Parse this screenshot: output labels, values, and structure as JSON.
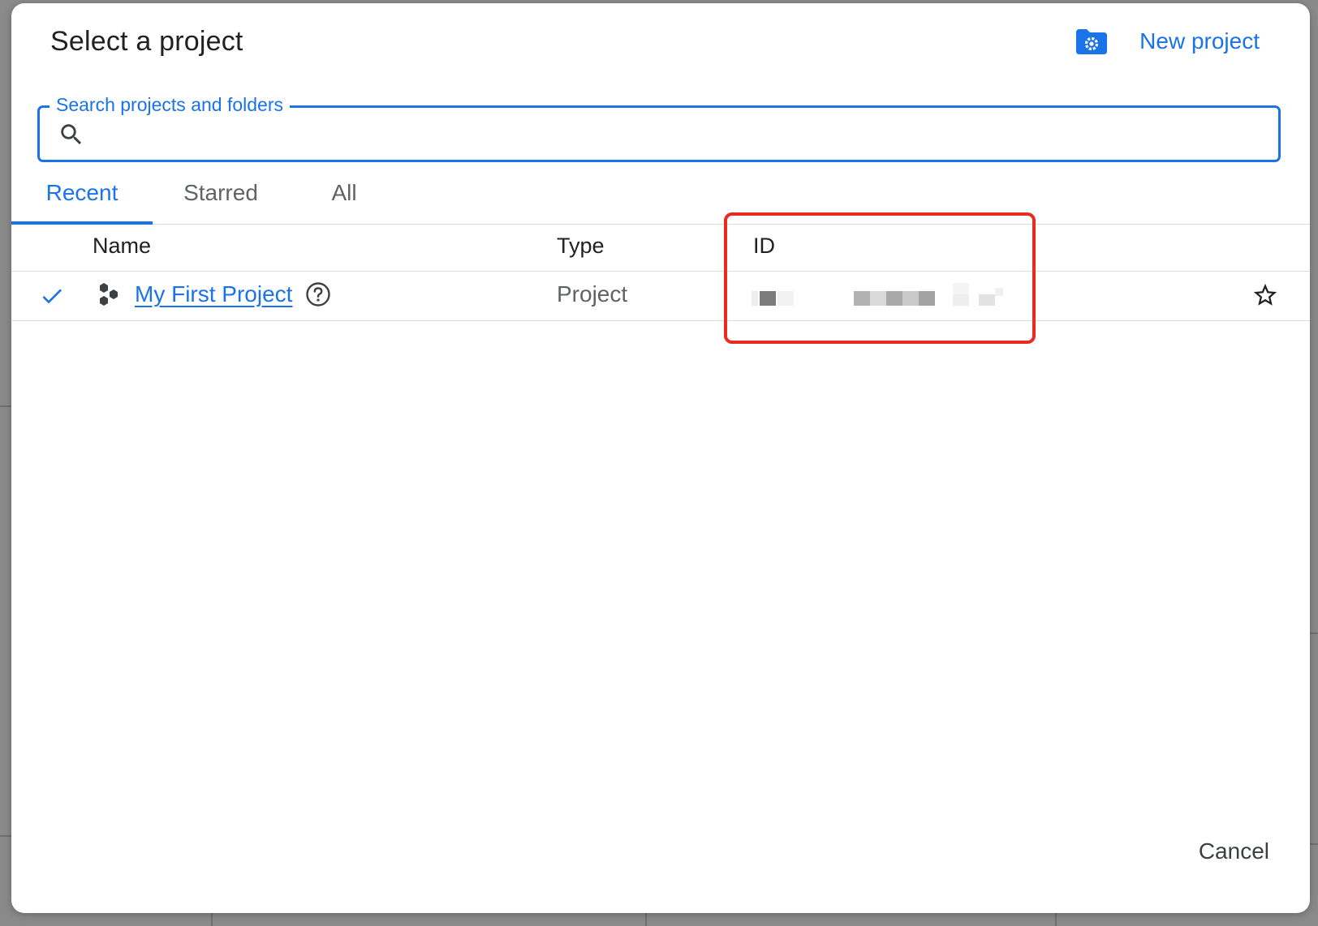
{
  "dialog": {
    "title": "Select a project",
    "new_project_label": "New project"
  },
  "search": {
    "label": "Search projects and folders",
    "value": ""
  },
  "tabs": [
    {
      "label": "Recent",
      "active": true
    },
    {
      "label": "Starred",
      "active": false
    },
    {
      "label": "All",
      "active": false
    }
  ],
  "table": {
    "columns": {
      "name": "Name",
      "type": "Type",
      "id": "ID"
    },
    "rows": [
      {
        "selected": true,
        "name": "My First Project",
        "type": "Project",
        "id_redacted": true,
        "starred": false
      }
    ]
  },
  "footer": {
    "cancel_label": "Cancel"
  },
  "colors": {
    "accent": "#1a73e8",
    "highlight": "#ea2b1f"
  },
  "icons": [
    "folder-settings-icon",
    "search-icon",
    "check-icon",
    "project-hexagons-icon",
    "help-icon",
    "star-outline-icon"
  ]
}
